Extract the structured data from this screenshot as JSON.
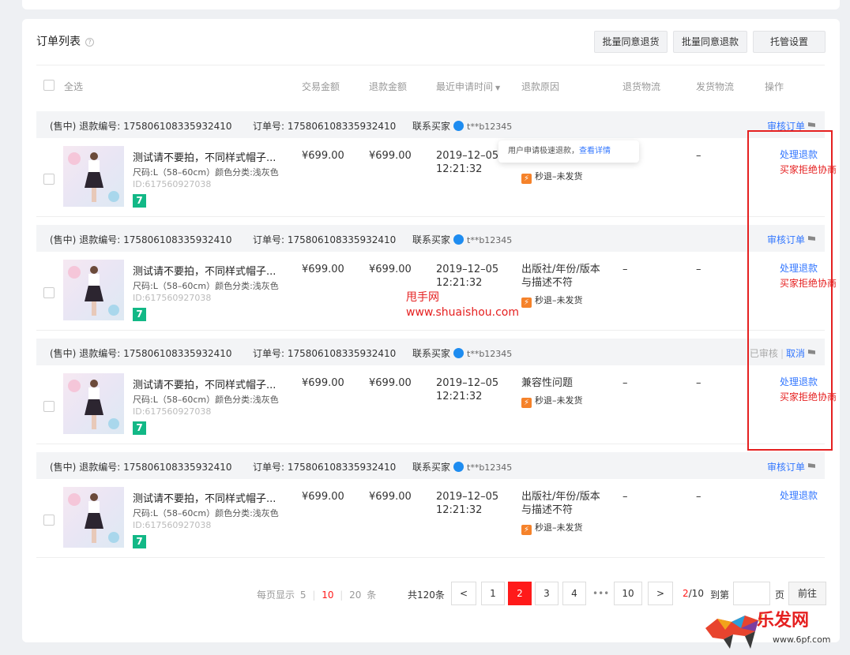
{
  "header": {
    "title": "订单列表",
    "help_icon": "?",
    "buttons": [
      "批量同意退货",
      "批量同意退款",
      "托管设置"
    ]
  },
  "columns": {
    "select_all": "全选",
    "trade_amount": "交易金额",
    "refund_amount": "退款金额",
    "apply_time": "最近申请时间",
    "reason": "退款原因",
    "return_logistics": "退货物流",
    "ship_logistics": "发货物流",
    "action": "操作"
  },
  "groups": [
    {
      "status": "(售中)",
      "refund_label": "退款编号:",
      "refund_no": "175806108335932410",
      "order_label": "订单号:",
      "order_no": "175806108335932410",
      "buyer_label": "联系买家",
      "buyer_nick": "t**b12345",
      "head_action": "审核订单",
      "product_name": "测试请不要拍，不同样式帽子...",
      "spec": "尺码:L（58–60cm）颜色分类:浅灰色",
      "pid": "ID:617560927038",
      "tag": "7",
      "trade_amount": "¥699.00",
      "refund_amount": "¥699.00",
      "date": "2019–12–05",
      "time": "12:21:32",
      "reason": "",
      "reason2": "",
      "fast_tag": "秒退–未发货",
      "return_logistics": "",
      "ship_logistics": "–",
      "action1": "处理退款",
      "action2": "买家拒绝协商"
    },
    {
      "status": "(售中)",
      "refund_label": "退款编号:",
      "refund_no": "175806108335932410",
      "order_label": "订单号:",
      "order_no": "175806108335932410",
      "buyer_label": "联系买家",
      "buyer_nick": "t**b12345",
      "head_action": "审核订单",
      "product_name": "测试请不要拍，不同样式帽子...",
      "spec": "尺码:L（58–60cm）颜色分类:浅灰色",
      "pid": "ID:617560927038",
      "tag": "7",
      "trade_amount": "¥699.00",
      "refund_amount": "¥699.00",
      "date": "2019–12–05",
      "time": "12:21:32",
      "reason": "出版社/年份/版本",
      "reason2": "与描述不符",
      "fast_tag": "秒退–未发货",
      "return_logistics": "–",
      "ship_logistics": "–",
      "action1": "处理退款",
      "action2": "买家拒绝协商"
    },
    {
      "status": "(售中)",
      "refund_label": "退款编号:",
      "refund_no": "175806108335932410",
      "order_label": "订单号:",
      "order_no": "175806108335932410",
      "buyer_label": "联系买家",
      "buyer_nick": "t**b12345",
      "head_status": "已审核",
      "head_cancel": "取消",
      "product_name": "测试请不要拍，不同样式帽子...",
      "spec": "尺码:L（58–60cm）颜色分类:浅灰色",
      "pid": "ID:617560927038",
      "tag": "7",
      "trade_amount": "¥699.00",
      "refund_amount": "¥699.00",
      "date": "2019–12–05",
      "time": "12:21:32",
      "reason": "兼容性问题",
      "reason2": "",
      "fast_tag": "秒退–未发货",
      "return_logistics": "–",
      "ship_logistics": "–",
      "action1": "处理退款",
      "action2": "买家拒绝协商"
    },
    {
      "status": "(售中)",
      "refund_label": "退款编号:",
      "refund_no": "175806108335932410",
      "order_label": "订单号:",
      "order_no": "175806108335932410",
      "buyer_label": "联系买家",
      "buyer_nick": "t**b12345",
      "head_action": "审核订单",
      "product_name": "测试请不要拍，不同样式帽子...",
      "spec": "尺码:L（58–60cm）颜色分类:浅灰色",
      "pid": "ID:617560927038",
      "tag": "7",
      "trade_amount": "¥699.00",
      "refund_amount": "¥699.00",
      "date": "2019–12–05",
      "time": "12:21:32",
      "reason": "出版社/年份/版本",
      "reason2": "与描述不符",
      "fast_tag": "秒退–未发货",
      "return_logistics": "–",
      "ship_logistics": "–",
      "action1": "处理退款",
      "action2": ""
    }
  ],
  "tooltip": {
    "text": "用户申请极速退款，",
    "link": "查看详情"
  },
  "watermark": {
    "line1": "甩手网",
    "line2": "www.shuaishou.com"
  },
  "pagination": {
    "per_page_label": "每页显示",
    "per_page_options": [
      "5",
      "10",
      "20"
    ],
    "per_page_selected": "10",
    "per_page_unit": "条",
    "total": "共120条",
    "prev": "<",
    "pages": [
      "1",
      "2",
      "3",
      "4"
    ],
    "ellipsis": "•••",
    "last_page": "10",
    "next": ">",
    "current_page": "2",
    "total_pages": "/10",
    "goto_label": "到第",
    "goto_value": "",
    "page_unit": "页",
    "goto_button": "前往"
  },
  "logo": {
    "name": "乐发网",
    "url": "www.6pf.com"
  },
  "colors": {
    "accent": "#3377ff",
    "danger": "#e52020",
    "active_page": "#ff1a1a",
    "seven_tag": "#12b886",
    "fast_bolt": "#f5822a"
  }
}
